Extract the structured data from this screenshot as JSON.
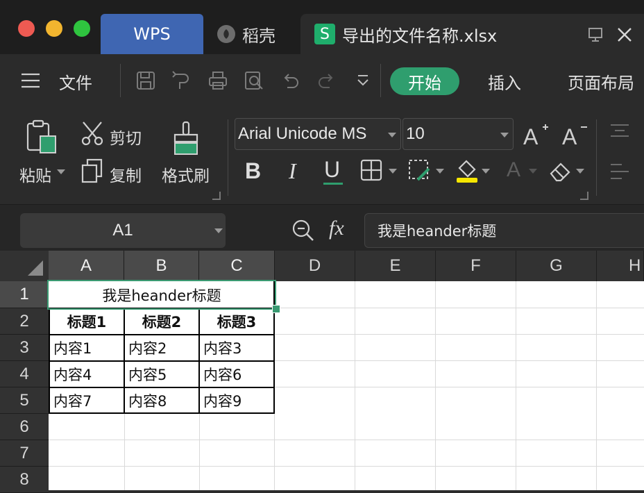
{
  "window": {
    "tabs": {
      "wps": "WPS",
      "daoke": "稻壳",
      "file": "导出的文件名称.xlsx"
    },
    "file_badge": "S"
  },
  "menu": {
    "hamburger_label": "文件",
    "tabs": [
      "开始",
      "插入",
      "页面布局"
    ]
  },
  "ribbon": {
    "paste": "粘贴",
    "cut": "剪切",
    "copy": "复制",
    "format_painter": "格式刷",
    "font_name": "Arial Unicode MS",
    "font_size": "10",
    "bold": "B",
    "italic": "I",
    "underline": "U"
  },
  "formula_bar": {
    "name_box": "A1",
    "fx": "fx",
    "content": "我是heander标题"
  },
  "sheet": {
    "columns": [
      "A",
      "B",
      "C",
      "D",
      "E",
      "F",
      "G",
      "H"
    ],
    "rows": [
      "1",
      "2",
      "3",
      "4",
      "5",
      "6",
      "7",
      "8"
    ],
    "merged_title": "我是heander标题",
    "headers": [
      "标题1",
      "标题2",
      "标题3"
    ],
    "data": [
      [
        "内容1",
        "内容2",
        "内容3"
      ],
      [
        "内容4",
        "内容5",
        "内容6"
      ],
      [
        "内容7",
        "内容8",
        "内容9"
      ]
    ]
  },
  "colors": {
    "accent": "#2f9e6e",
    "wps_tab": "#3f66b2",
    "selection": "#3a9a72"
  }
}
